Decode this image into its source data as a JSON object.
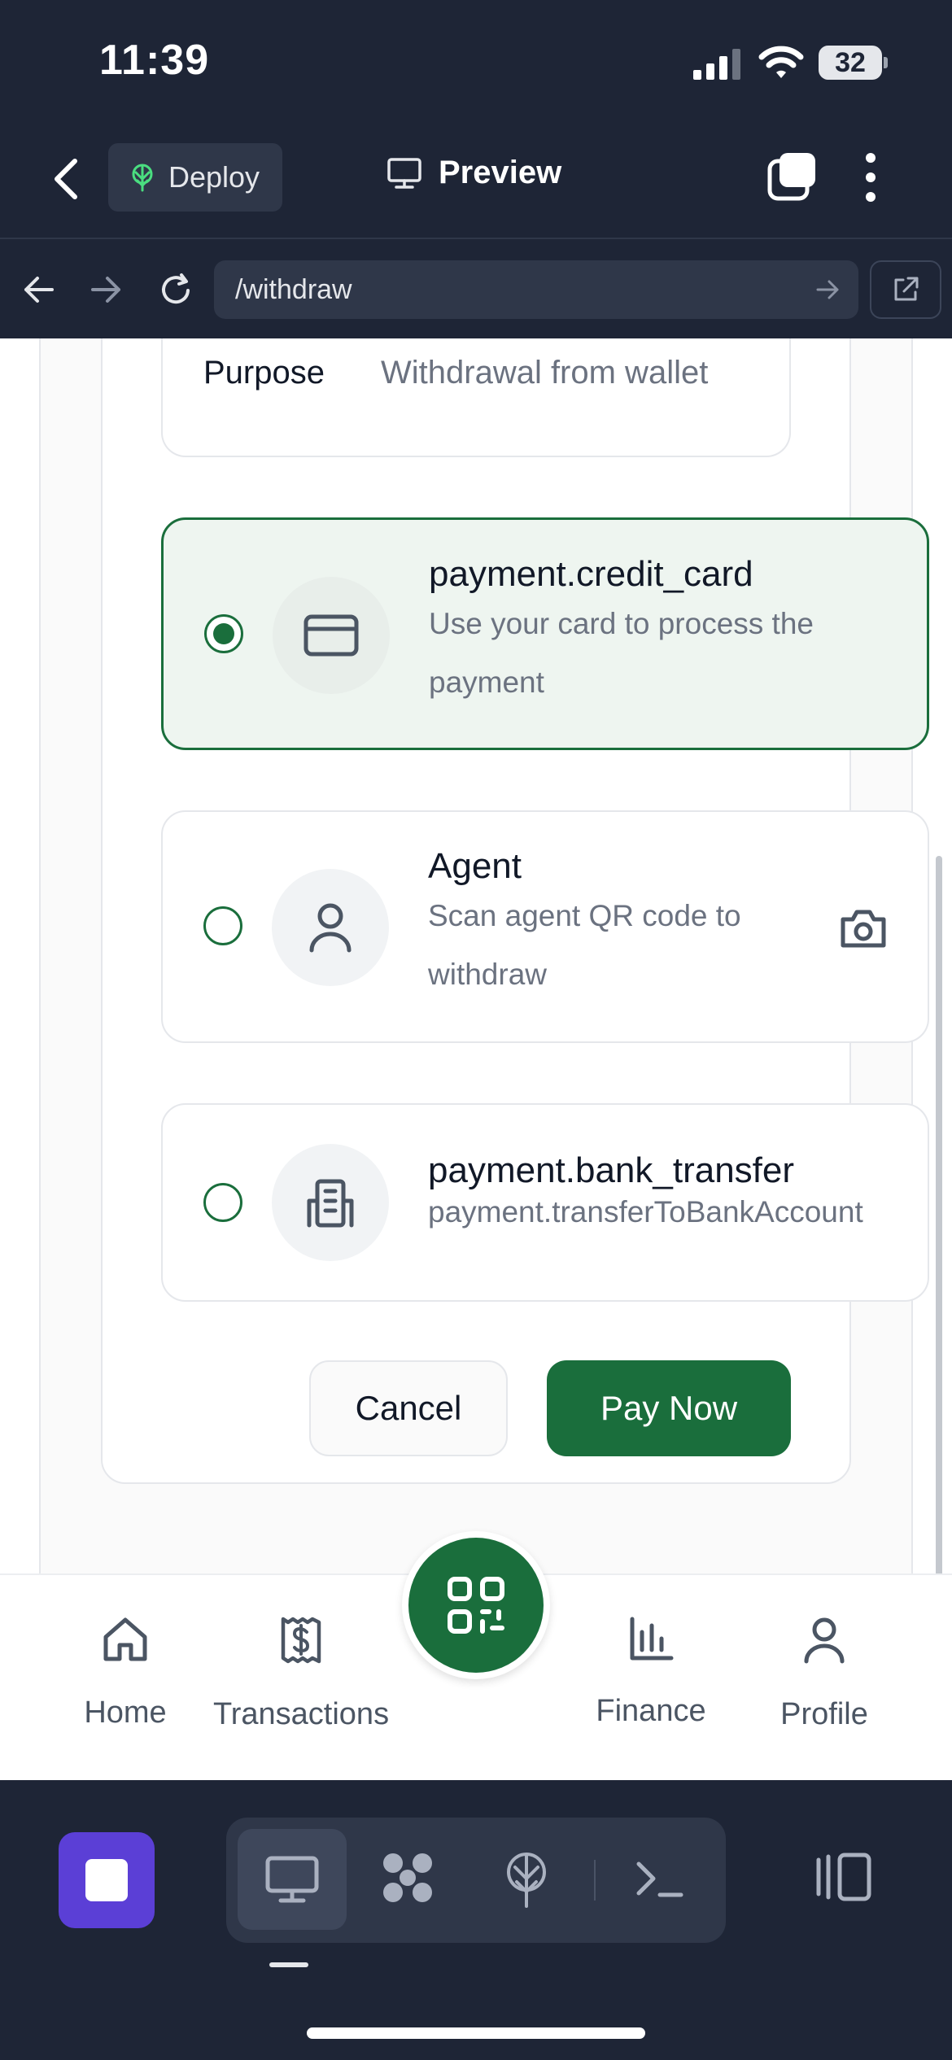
{
  "status_bar": {
    "time": "11:39",
    "battery": "32"
  },
  "header": {
    "deploy_label": "Deploy",
    "preview_label": "Preview"
  },
  "browser": {
    "url": "/withdraw"
  },
  "purpose": {
    "label": "Purpose",
    "value": "Withdrawal from wallet"
  },
  "payment_options": [
    {
      "title": "payment.credit_card",
      "description": "Use your card to process the payment",
      "selected": true,
      "icon": "credit-card-icon"
    },
    {
      "title": "Agent",
      "description": "Scan agent QR code to withdraw",
      "selected": false,
      "icon": "user-icon",
      "action_icon": "camera-icon"
    },
    {
      "title": "payment.bank_transfer",
      "description": "payment.transferToBankAccount",
      "selected": false,
      "icon": "bank-building-icon"
    }
  ],
  "actions": {
    "cancel_label": "Cancel",
    "pay_label": "Pay Now"
  },
  "bottom_nav": {
    "items": [
      {
        "label": "Home",
        "icon": "home-icon"
      },
      {
        "label": "Transactions",
        "icon": "receipt-dollar-icon"
      },
      {
        "label": "Finance",
        "icon": "bar-chart-icon"
      },
      {
        "label": "Profile",
        "icon": "user-icon"
      }
    ],
    "center_action_icon": "qr-code-icon"
  },
  "ide_toolbar": {
    "tools": [
      "monitor-icon",
      "grid-blocks-icon",
      "deploy-tree-icon",
      "terminal-icon"
    ],
    "active_tool": "monitor-icon"
  },
  "colors": {
    "primary": "#1a6e3c",
    "chrome_bg": "#1e2536",
    "chrome_surface": "#2f3749",
    "stop_button": "#5b3fd6",
    "selected_card_bg": "#eef5f0"
  }
}
